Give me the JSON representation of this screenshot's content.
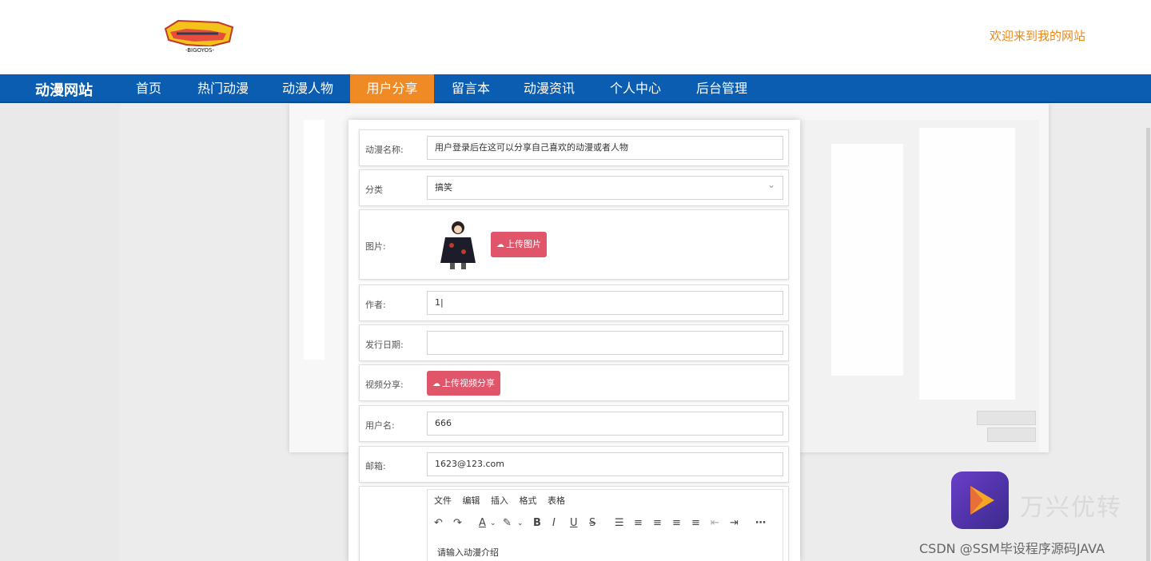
{
  "header": {
    "logo_text": "DIGIMON · BIGOYOS",
    "welcome": "欢迎来到我的网站"
  },
  "nav": {
    "brand": "动漫网站",
    "items": [
      {
        "label": "首页",
        "active": false
      },
      {
        "label": "热门动漫",
        "active": false
      },
      {
        "label": "动漫人物",
        "active": false
      },
      {
        "label": "用户分享",
        "active": true
      },
      {
        "label": "留言本",
        "active": false
      },
      {
        "label": "动漫资讯",
        "active": false
      },
      {
        "label": "个人中心",
        "active": false
      },
      {
        "label": "后台管理",
        "active": false
      }
    ]
  },
  "form": {
    "name_label": "动漫名称:",
    "name_value": "用户登录后在这可以分享自己喜欢的动漫或者人物",
    "category_label": "分类",
    "category_value": "搞笑",
    "image_label": "图片:",
    "image_upload": "上传图片",
    "author_label": "作者:",
    "author_value": "1|",
    "date_label": "发行日期:",
    "date_value": "",
    "video_label": "视频分享:",
    "video_upload": "上传视频分享",
    "username_label": "用户名:",
    "username_value": "666",
    "email_label": "邮箱:",
    "email_value": "1623@123.com",
    "editor": {
      "menus": [
        "文件",
        "编辑",
        "插入",
        "格式",
        "表格"
      ],
      "placeholder": "请输入动漫介绍"
    }
  },
  "colors": {
    "nav_bg": "#0a5db0",
    "nav_active": "#f08a24",
    "welcome": "#e8891d",
    "upload_btn": "#e0556a"
  },
  "watermark": {
    "brand": "万兴优转",
    "credit": "CSDN @SSM毕设程序源码JAVA"
  }
}
